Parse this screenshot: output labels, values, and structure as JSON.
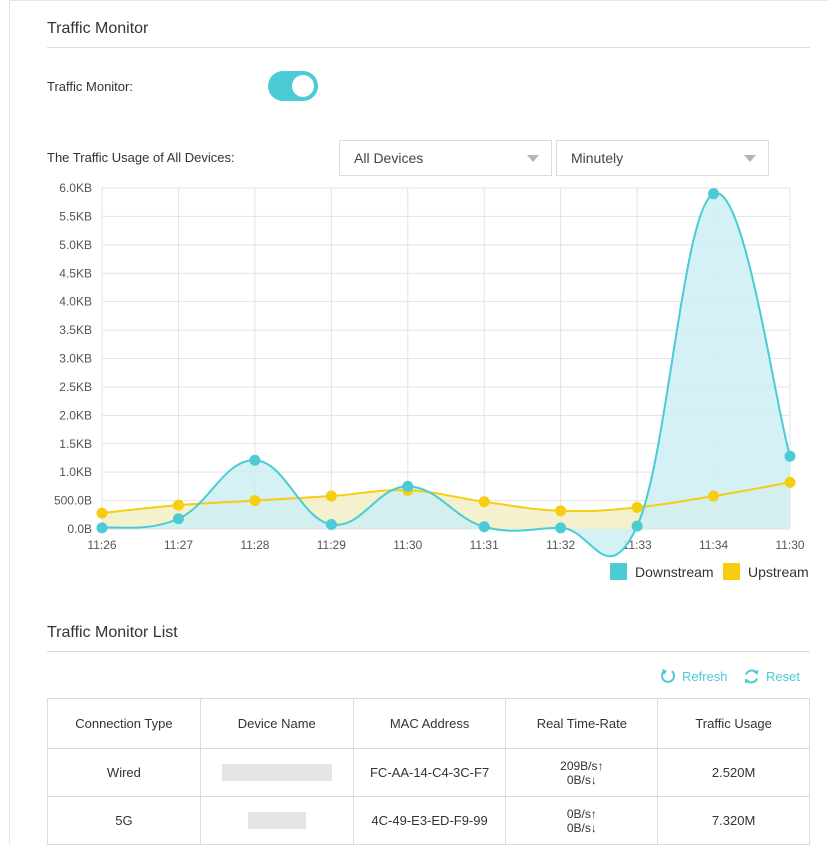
{
  "page": {
    "title": "Traffic Monitor"
  },
  "toggle_section": {
    "label": "Traffic Monitor:",
    "enabled": true
  },
  "usage": {
    "label": "The Traffic Usage of All Devices:",
    "device_select": "All Devices",
    "interval_select": "Minutely"
  },
  "chart_data": {
    "type": "area",
    "categories": [
      "11:26",
      "11:27",
      "11:28",
      "11:29",
      "11:30",
      "11:31",
      "11:32",
      "11:33",
      "11:34",
      "11:30"
    ],
    "y_ticks": [
      "0.0B",
      "500.0B",
      "1.0KB",
      "1.5KB",
      "2.0KB",
      "2.5KB",
      "3.0KB",
      "3.5KB",
      "4.0KB",
      "4.5KB",
      "5.0KB",
      "5.5KB",
      "6.0KB"
    ],
    "ylim": [
      0,
      6000
    ],
    "grid": true,
    "legend_position": "bottom-right",
    "series": [
      {
        "name": "Downstream",
        "color": "#4acbd6",
        "fill": "#cdeff3",
        "values": [
          20,
          180,
          1210,
          80,
          750,
          40,
          20,
          50,
          5900,
          1280
        ]
      },
      {
        "name": "Upstream",
        "color": "#f7cd12",
        "fill": "#f2f0c6",
        "values": [
          280,
          420,
          500,
          580,
          680,
          480,
          320,
          380,
          580,
          820
        ]
      }
    ]
  },
  "list": {
    "title": "Traffic Monitor List",
    "refresh_label": "Refresh",
    "reset_label": "Reset",
    "headers": [
      "Connection Type",
      "Device Name",
      "MAC Address",
      "Real Time-Rate",
      "Traffic Usage"
    ],
    "rows": [
      {
        "type": "Wired",
        "mac": "FC-AA-14-C4-3C-F7",
        "rate_up": "209B/s↑",
        "rate_down": "0B/s↓",
        "usage": "2.520M"
      },
      {
        "type": "5G",
        "mac": "4C-49-E3-ED-F9-99",
        "rate_up": "0B/s↑",
        "rate_down": "0B/s↓",
        "usage": "7.320M"
      }
    ]
  }
}
